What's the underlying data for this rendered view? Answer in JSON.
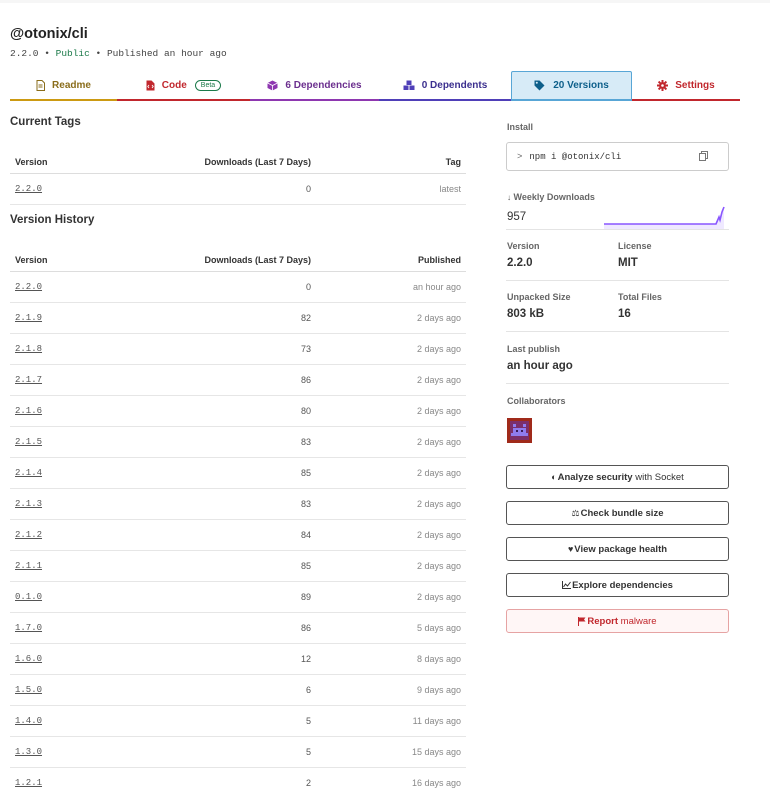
{
  "package": {
    "name": "@otonix/cli",
    "version": "2.2.0",
    "visibility": "Public",
    "published": "Published an hour ago",
    "sep": "•"
  },
  "tabs": {
    "readme": "Readme",
    "code": "Code",
    "code_badge": "Beta",
    "dependencies": "6 Dependencies",
    "dependents": "0 Dependents",
    "versions": "20 Versions",
    "settings": "Settings"
  },
  "current_tags": {
    "title": "Current Tags",
    "headers": [
      "Version",
      "Downloads (Last 7 Days)",
      "Tag"
    ],
    "rows": [
      {
        "version": "2.2.0",
        "downloads": "0",
        "tag": "latest"
      }
    ]
  },
  "version_history": {
    "title": "Version History",
    "headers": [
      "Version",
      "Downloads (Last 7 Days)",
      "Published"
    ],
    "rows": [
      {
        "version": "2.2.0",
        "downloads": "0",
        "published": "an hour ago"
      },
      {
        "version": "2.1.9",
        "downloads": "82",
        "published": "2 days ago"
      },
      {
        "version": "2.1.8",
        "downloads": "73",
        "published": "2 days ago"
      },
      {
        "version": "2.1.7",
        "downloads": "86",
        "published": "2 days ago"
      },
      {
        "version": "2.1.6",
        "downloads": "80",
        "published": "2 days ago"
      },
      {
        "version": "2.1.5",
        "downloads": "83",
        "published": "2 days ago"
      },
      {
        "version": "2.1.4",
        "downloads": "85",
        "published": "2 days ago"
      },
      {
        "version": "2.1.3",
        "downloads": "83",
        "published": "2 days ago"
      },
      {
        "version": "2.1.2",
        "downloads": "84",
        "published": "2 days ago"
      },
      {
        "version": "2.1.1",
        "downloads": "85",
        "published": "2 days ago"
      },
      {
        "version": "0.1.0",
        "downloads": "89",
        "published": "2 days ago"
      },
      {
        "version": "1.7.0",
        "downloads": "86",
        "published": "5 days ago"
      },
      {
        "version": "1.6.0",
        "downloads": "12",
        "published": "8 days ago"
      },
      {
        "version": "1.5.0",
        "downloads": "6",
        "published": "9 days ago"
      },
      {
        "version": "1.4.0",
        "downloads": "5",
        "published": "11 days ago"
      },
      {
        "version": "1.3.0",
        "downloads": "5",
        "published": "15 days ago"
      },
      {
        "version": "1.2.1",
        "downloads": "2",
        "published": "16 days ago"
      }
    ]
  },
  "sidebar": {
    "install_label": "Install",
    "install_prompt": ">",
    "install_command": "npm i @otonix/cli",
    "weekly_downloads_label": "Weekly Downloads",
    "weekly_downloads_value": "957",
    "version_label": "Version",
    "version_value": "2.2.0",
    "license_label": "License",
    "license_value": "MIT",
    "unpacked_size_label": "Unpacked Size",
    "unpacked_size_value": "803 kB",
    "total_files_label": "Total Files",
    "total_files_value": "16",
    "last_publish_label": "Last publish",
    "last_publish_value": "an hour ago",
    "collaborators_label": "Collaborators"
  },
  "actions": {
    "analyze_bold": "Analyze security",
    "analyze_rest": " with Socket",
    "bundle": "Check bundle size",
    "health": "View package health",
    "explore": "Explore dependencies",
    "report_bold": "Report",
    "report_rest": " malware"
  },
  "colors": {
    "accent_purple": "#8956ff",
    "tab_versions_bg": "#d7ebf7",
    "report_red": "#c1272d"
  }
}
